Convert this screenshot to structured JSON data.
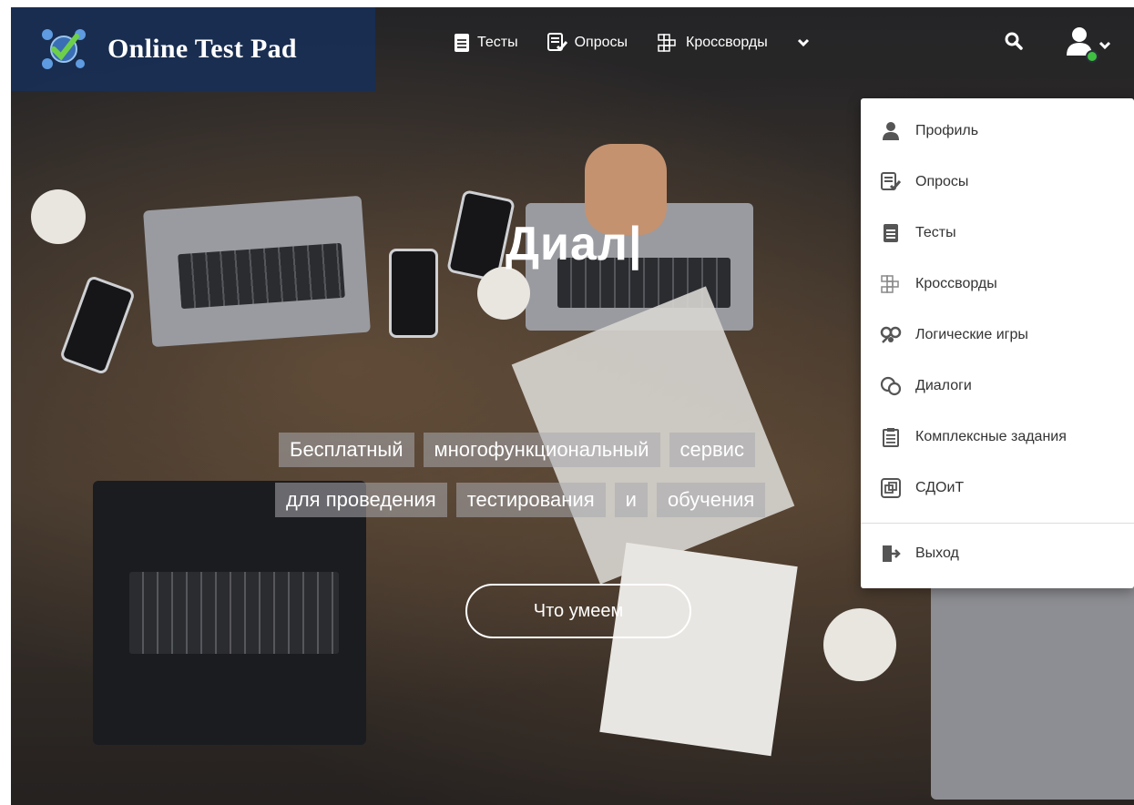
{
  "header": {
    "logo_text": "Online Test Pad",
    "nav": [
      {
        "label": "Тесты",
        "icon": "test-doc-icon"
      },
      {
        "label": "Опросы",
        "icon": "survey-check-icon"
      },
      {
        "label": "Кроссворды",
        "icon": "crossword-icon"
      }
    ],
    "more_icon": "chevron-down-icon",
    "search_icon": "search-icon",
    "user_icon": "user-icon"
  },
  "hero": {
    "title": "Диал|",
    "tagline_line1": [
      "Бесплатный",
      "многофункциональный",
      "сервис"
    ],
    "tagline_line2": [
      "для проведения",
      "тестирования",
      "и",
      "обучения"
    ],
    "cta_label": "Что умеем"
  },
  "dropdown": {
    "items": [
      {
        "label": "Профиль",
        "icon": "user-icon"
      },
      {
        "label": "Опросы",
        "icon": "survey-check-icon"
      },
      {
        "label": "Тесты",
        "icon": "test-doc-icon"
      },
      {
        "label": "Кроссворды",
        "icon": "crossword-icon"
      },
      {
        "label": "Логические игры",
        "icon": "puzzle-icon"
      },
      {
        "label": "Диалоги",
        "icon": "dialog-icon"
      },
      {
        "label": "Комплексные задания",
        "icon": "clipboard-icon"
      },
      {
        "label": "СДОиТ",
        "icon": "windows-icon"
      }
    ],
    "logout": {
      "label": "Выход",
      "icon": "logout-icon"
    }
  },
  "colors": {
    "logo_bg": "#172f55",
    "online_status": "#3fbf3f",
    "icon_gray": "#555555"
  }
}
